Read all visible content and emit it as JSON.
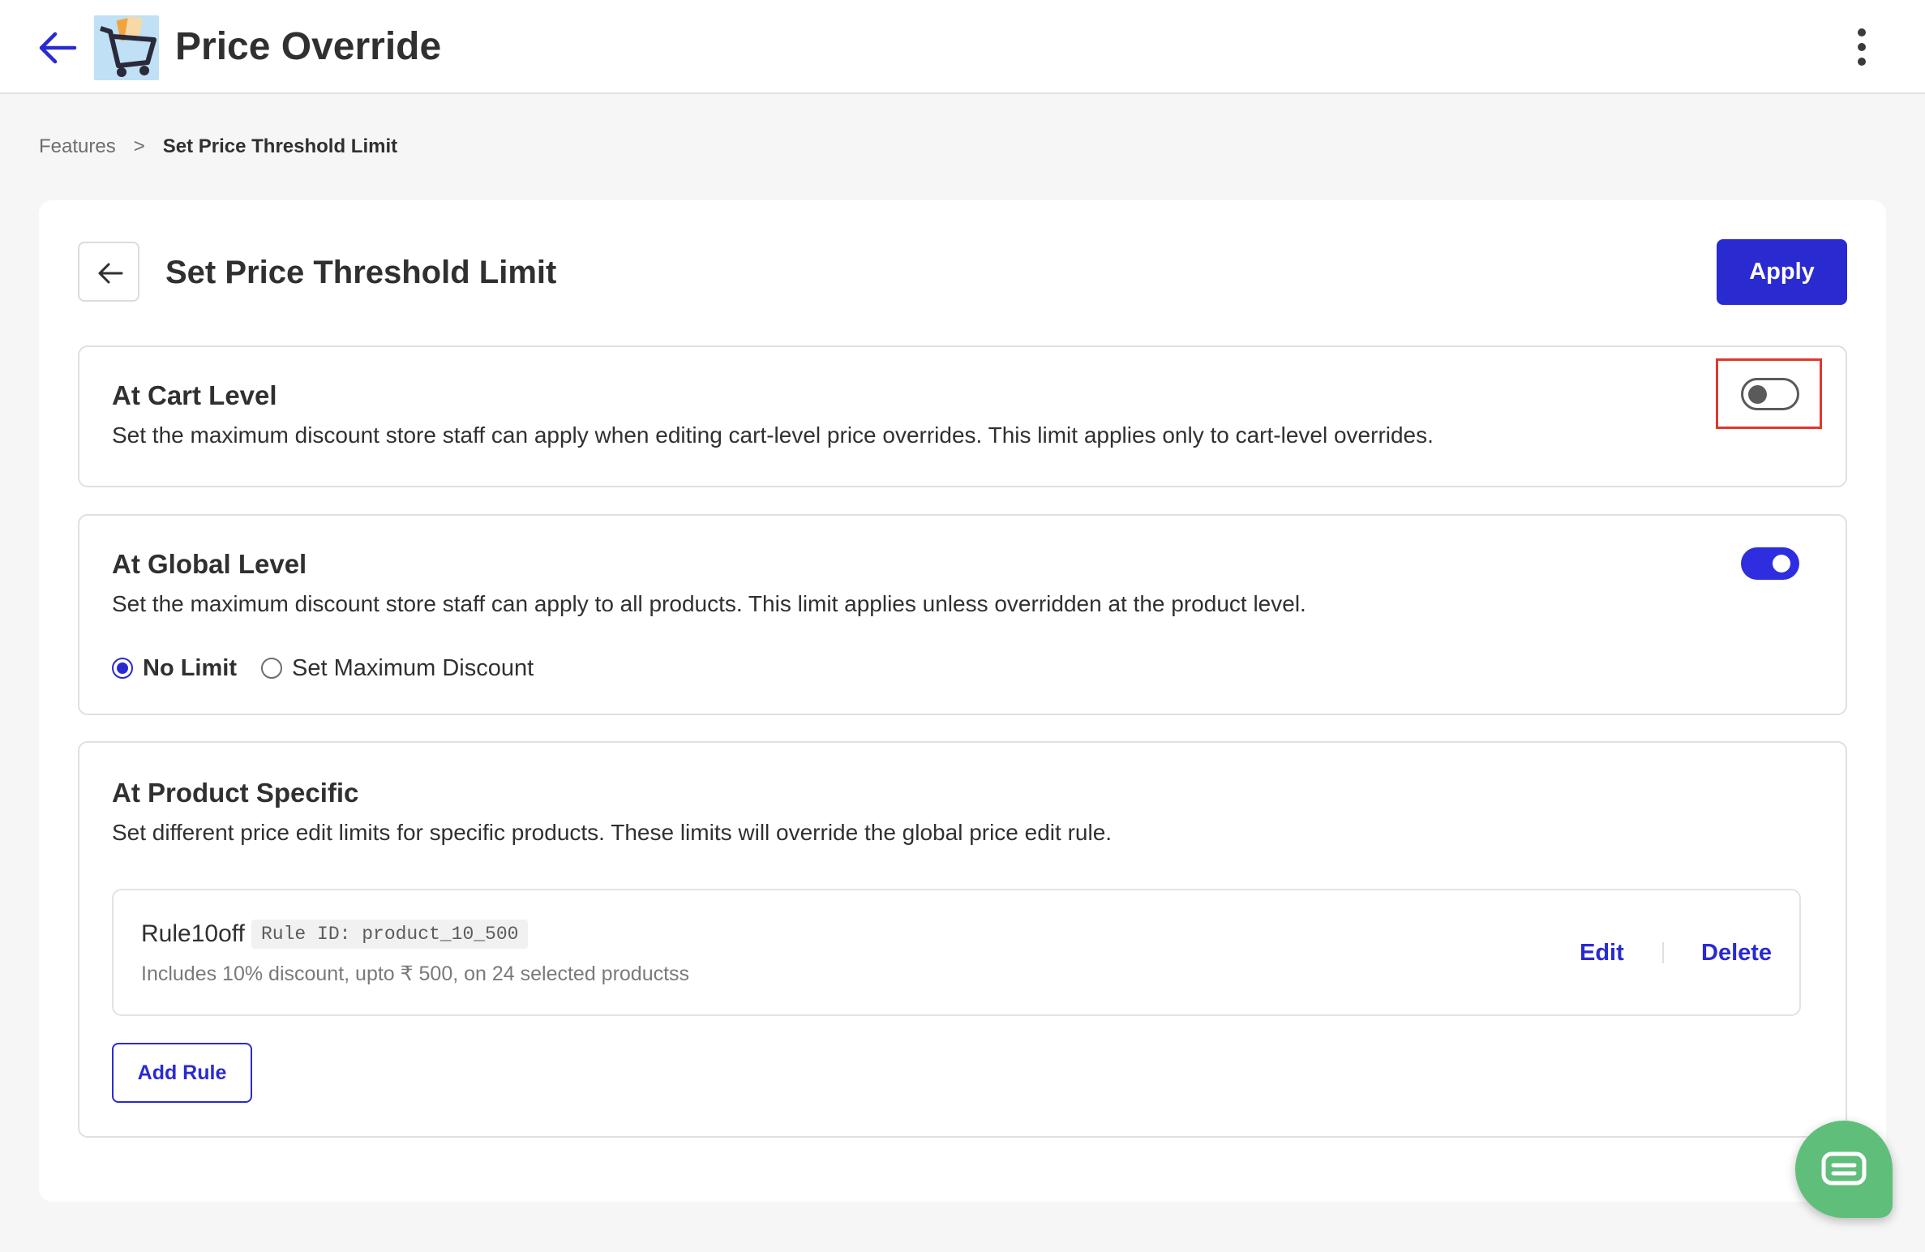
{
  "app": {
    "title": "Price Override"
  },
  "breadcrumb": {
    "parent": "Features",
    "separator": ">",
    "current": "Set Price Threshold Limit"
  },
  "header": {
    "title": "Set Price Threshold Limit",
    "apply_label": "Apply"
  },
  "sections": {
    "cart": {
      "title": "At Cart Level",
      "description": "Set the maximum discount store staff can apply when editing cart-level price overrides. This limit applies only to cart-level overrides.",
      "toggle_on": false
    },
    "global": {
      "title": "At Global Level",
      "description": "Set the maximum discount store staff can apply to all products. This limit applies unless overridden at the product level.",
      "toggle_on": true,
      "options": [
        {
          "label": "No Limit",
          "selected": true
        },
        {
          "label": "Set Maximum Discount",
          "selected": false
        }
      ]
    },
    "product": {
      "title": "At Product Specific",
      "description": "Set different price edit limits for specific products. These limits will override the global price edit rule.",
      "rules": [
        {
          "name": "Rule10off",
          "id_label": "Rule ID: product_10_500",
          "summary": "Includes 10% discount, upto ₹ 500, on 24 selected productss",
          "edit_label": "Edit",
          "delete_label": "Delete"
        }
      ],
      "add_rule_label": "Add Rule"
    }
  },
  "colors": {
    "accent": "#2a2ad1",
    "highlight": "#e0382e",
    "chat": "#5fbf7a"
  },
  "icons": [
    "back-arrow-icon",
    "cart-logo-icon",
    "more-vertical-icon",
    "chat-icon"
  ]
}
